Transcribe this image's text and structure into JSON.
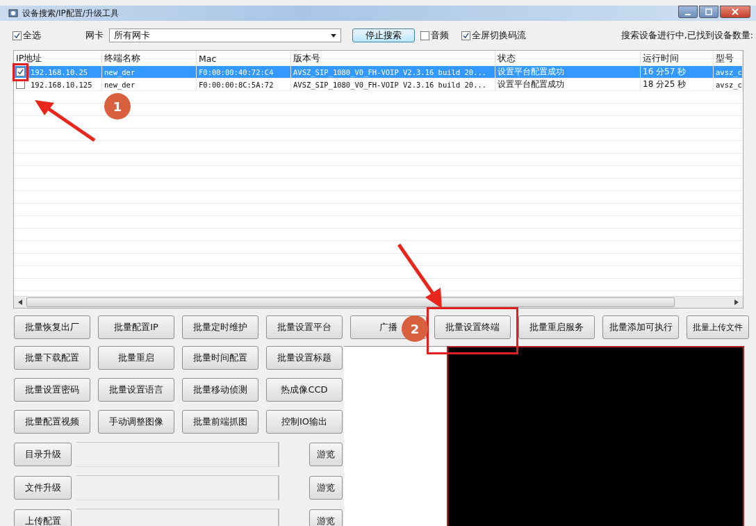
{
  "window": {
    "title": "设备搜索/IP配置/升级工具"
  },
  "toolbar": {
    "select_all": {
      "label": "全选",
      "checked": true
    },
    "nic": {
      "label": "网卡",
      "value": "所有网卡"
    },
    "stop_button": "停止搜索",
    "audio": {
      "label": "音频",
      "checked": false
    },
    "fullscreen_switch": {
      "label": "全屏切换码流",
      "checked": true
    },
    "status": "搜索设备进行中,已找到设备数量:"
  },
  "table": {
    "columns": [
      "IP地址",
      "终端名称",
      "Mac",
      "版本号",
      "状态",
      "运行时间",
      "型号"
    ],
    "rows": [
      {
        "selected": true,
        "checked": true,
        "cells": [
          "192.168.10.25",
          "new_der",
          "F0:00:00:40:72:C4",
          "AVSZ_SIP_1080_V0_FH-VOIP V2.3.16 build 20...",
          "设置平台配置成功",
          "16 分57 秒",
          "avsz_c"
        ]
      },
      {
        "selected": false,
        "checked": false,
        "cells": [
          "192.168.10.125",
          "new_der",
          "F0:00:00:8C:5A:72",
          "AVSZ_SIP_1080_V0_FH-VOIP V2.3.16 build 20...",
          "设置平台配置成功",
          "18 分25 秒",
          "avsz_c"
        ]
      }
    ]
  },
  "top_buttons": [
    "批量恢复出厂",
    "批量配置IP",
    "批量定时维护",
    "批量设置平台",
    "广播",
    "批量设置终端",
    "批量重启服务",
    "批量添加可执行",
    "批量上传文件"
  ],
  "grid_buttons": [
    [
      "批量下载配置",
      "批量重启",
      "批量时间配置",
      "批量设置标题"
    ],
    [
      "批量设置密码",
      "批量设置语言",
      "批量移动侦测",
      "热成像CCD"
    ],
    [
      "批量配置视频",
      "手动调整图像",
      "批量前端抓图",
      "控制IO输出"
    ]
  ],
  "upgrade_rows": [
    {
      "label": "目录升级",
      "browse": "游览"
    },
    {
      "label": "文件升级",
      "browse": "游览"
    },
    {
      "label": "上传配置",
      "browse": "游览"
    }
  ],
  "annotations": [
    "1",
    "2"
  ]
}
